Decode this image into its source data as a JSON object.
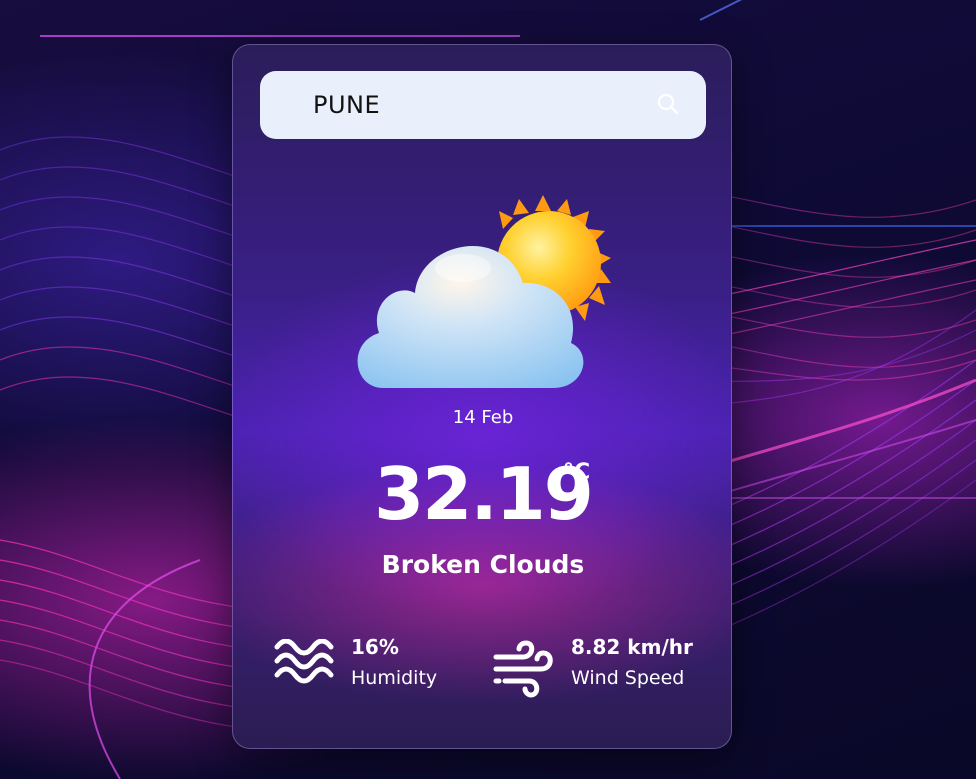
{
  "search": {
    "value": "PUNE"
  },
  "weather": {
    "date": "14 Feb",
    "temperature": "32.19",
    "unit": "°C",
    "condition": "Broken Clouds",
    "icon": "sun-behind-cloud-icon"
  },
  "humidity": {
    "value": "16%",
    "label": "Humidity",
    "icon": "waves-icon"
  },
  "wind": {
    "value": "8.82 km/hr",
    "label": "Wind Speed",
    "icon": "wind-icon"
  },
  "colors": {
    "search_bg": "#e9f0fc",
    "text": "#ffffff",
    "card_accent_purple": "#4b23b2",
    "card_accent_pink": "#e12da5",
    "sun": "#ffb21e",
    "cloud": "#a9d4f5"
  }
}
